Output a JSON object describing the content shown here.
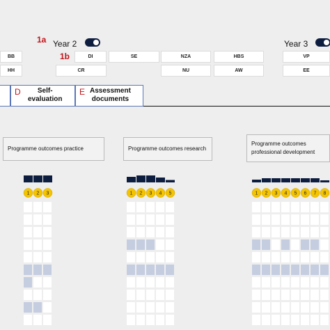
{
  "header": {
    "marker_1a": "1a",
    "marker_1b": "1b",
    "year2_label": "Year 2",
    "year3_label": "Year 3"
  },
  "courses": {
    "year1_left": [
      "BB",
      "HH"
    ],
    "year2_col1": [
      "DI",
      "CR"
    ],
    "year2_col2": [
      "SE"
    ],
    "year2_col3": [
      "NZA",
      "NU"
    ],
    "year2_col4": [
      "HBS",
      "AW"
    ],
    "year3_col1": [
      "VP",
      "EE"
    ]
  },
  "tabs": [
    {
      "letter": "D",
      "label": "Self-\nevaluation"
    },
    {
      "letter": "E",
      "label": "Assessment\ndocuments"
    }
  ],
  "programme_boxes": [
    {
      "label": "Programme outcomes practice"
    },
    {
      "label": "Programme outcomes research"
    },
    {
      "label": "Programme outcomes professional development"
    }
  ],
  "colors": {
    "navy": "#0d1d3f",
    "yellow": "#f5c400",
    "highlight": "#c5cde0",
    "cell": "#ffffff",
    "red": "#c0151b"
  },
  "grids": [
    {
      "outcome_numbers": [
        "1",
        "2",
        "3"
      ],
      "bar_levels": [
        1.0,
        1.0,
        1.0
      ],
      "highlighted": [
        [
          5,
          0
        ],
        [
          5,
          1
        ],
        [
          5,
          2
        ],
        [
          6,
          0
        ],
        [
          8,
          0
        ],
        [
          8,
          1
        ]
      ]
    },
    {
      "outcome_numbers": [
        "1",
        "2",
        "3",
        "4",
        "5"
      ],
      "bar_levels": [
        0.8,
        1.0,
        1.0,
        0.7,
        0.35
      ],
      "highlighted": [
        [
          3,
          0
        ],
        [
          3,
          1
        ],
        [
          3,
          2
        ],
        [
          5,
          0
        ],
        [
          5,
          1
        ],
        [
          5,
          2
        ],
        [
          5,
          3
        ],
        [
          5,
          4
        ]
      ]
    },
    {
      "outcome_numbers": [
        "1",
        "2",
        "3",
        "4",
        "5",
        "6",
        "7",
        "8"
      ],
      "bar_levels": [
        0.4,
        0.6,
        0.6,
        0.6,
        0.6,
        0.6,
        0.6,
        0.3
      ],
      "highlighted": [
        [
          3,
          0
        ],
        [
          3,
          1
        ],
        [
          3,
          3
        ],
        [
          3,
          5
        ],
        [
          3,
          6
        ],
        [
          5,
          0
        ],
        [
          5,
          1
        ],
        [
          5,
          2
        ],
        [
          5,
          3
        ],
        [
          5,
          4
        ],
        [
          5,
          5
        ],
        [
          5,
          6
        ],
        [
          5,
          7
        ]
      ]
    }
  ]
}
